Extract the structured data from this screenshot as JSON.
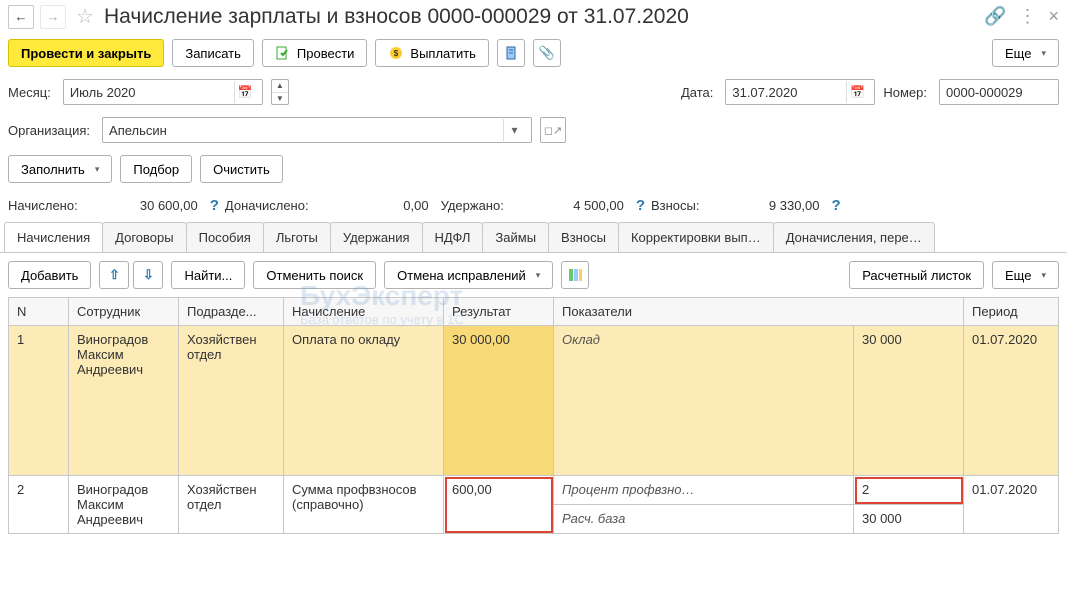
{
  "titlebar": {
    "title": "Начисление зарплаты и взносов 0000-000029 от 31.07.2020"
  },
  "toolbar": {
    "post_close": "Провести и закрыть",
    "save": "Записать",
    "post": "Провести",
    "pay": "Выплатить",
    "more": "Еще"
  },
  "fields": {
    "month_label": "Месяц:",
    "month_value": "Июль 2020",
    "date_label": "Дата:",
    "date_value": "31.07.2020",
    "number_label": "Номер:",
    "number_value": "0000-000029",
    "org_label": "Организация:",
    "org_value": "Апельсин",
    "fill": "Заполнить",
    "select": "Подбор",
    "clear": "Очистить"
  },
  "totals": {
    "accrued_label": "Начислено:",
    "accrued_value": "30 600,00",
    "extra_label": "Доначислено:",
    "extra_value": "0,00",
    "withheld_label": "Удержано:",
    "withheld_value": "4 500,00",
    "contrib_label": "Взносы:",
    "contrib_value": "9 330,00"
  },
  "tabs": [
    "Начисления",
    "Договоры",
    "Пособия",
    "Льготы",
    "Удержания",
    "НДФЛ",
    "Займы",
    "Взносы",
    "Корректировки вып…",
    "Доначисления, пере…"
  ],
  "tabtoolbar": {
    "add": "Добавить",
    "find": "Найти...",
    "cancel_search": "Отменить поиск",
    "cancel_fix": "Отмена исправлений",
    "payslip": "Расчетный листок",
    "more": "Еще"
  },
  "grid": {
    "headers": {
      "n": "N",
      "employee": "Сотрудник",
      "dept": "Подразде...",
      "accrual": "Начисление",
      "result": "Результат",
      "indicators": "Показатели",
      "period": "Период"
    },
    "rows": [
      {
        "n": "1",
        "employee": "Виноградов Максим Андреевич",
        "dept": "Хозяйствен отдел",
        "accrual": "Оплата по окладу",
        "result": "30 000,00",
        "indicator_name": "Оклад",
        "indicator_value": "30 000",
        "period": "01.07.2020"
      },
      {
        "n": "2",
        "employee": "Виноградов Максим Андреевич",
        "dept": "Хозяйствен отдел",
        "accrual": "Сумма профвзносов (справочно)",
        "result": "600,00",
        "indicator_name": "Процент профвзно…",
        "indicator_value": "2",
        "indicator2_name": "Расч. база",
        "indicator2_value": "30 000",
        "period": "01.07.2020"
      }
    ]
  },
  "watermark": {
    "title": "БухЭксперт",
    "sub": "База ответов по учету в 1С"
  }
}
